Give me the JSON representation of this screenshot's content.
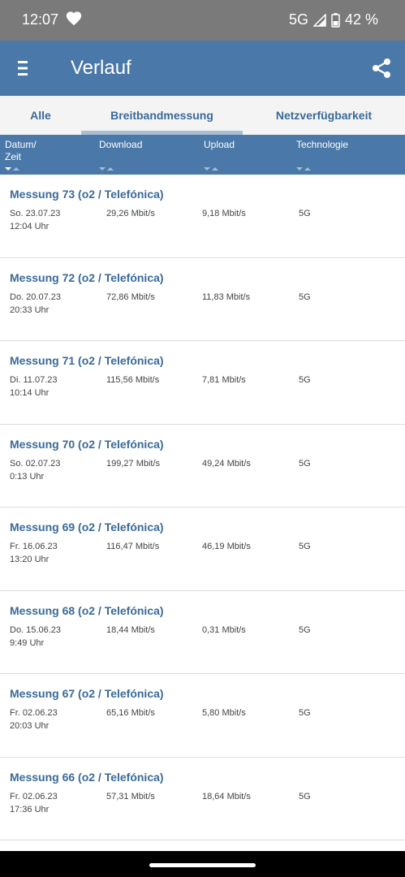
{
  "status_bar": {
    "time": "12:07",
    "network": "5G",
    "battery": "42 %",
    "icons": [
      "heart-icon",
      "signal-icon",
      "battery-icon"
    ]
  },
  "app_bar": {
    "title": "Verlauf",
    "icons": [
      "menu-icon",
      "share-icon"
    ]
  },
  "tabs": [
    {
      "label": "Alle",
      "selected": false
    },
    {
      "label": "Breitbandmessung",
      "selected": true
    },
    {
      "label": "Netzverfügbarkeit",
      "selected": false
    }
  ],
  "columns": {
    "date_line1": "Datum/",
    "date_line2": "Zeit",
    "download": "Download",
    "upload": "Upload",
    "technology": "Technologie"
  },
  "measurements": [
    {
      "title": "Messung 73 (o2 / Telefónica)",
      "date": "So. 23.07.23",
      "time": "12:04 Uhr",
      "download": "29,26 Mbit/s",
      "upload": "9,18 Mbit/s",
      "technology": "5G"
    },
    {
      "title": "Messung 72 (o2 / Telefónica)",
      "date": "Do. 20.07.23",
      "time": "20:33 Uhr",
      "download": "72,86 Mbit/s",
      "upload": "11,83 Mbit/s",
      "technology": "5G"
    },
    {
      "title": "Messung 71 (o2 / Telefónica)",
      "date": "Di. 11.07.23",
      "time": "10:14 Uhr",
      "download": "115,56 Mbit/s",
      "upload": "7,81 Mbit/s",
      "technology": "5G"
    },
    {
      "title": "Messung 70 (o2 / Telefónica)",
      "date": "So. 02.07.23",
      "time": "0:13 Uhr",
      "download": "199,27 Mbit/s",
      "upload": "49,24 Mbit/s",
      "technology": "5G"
    },
    {
      "title": "Messung 69 (o2 / Telefónica)",
      "date": "Fr. 16.06.23",
      "time": "13:20 Uhr",
      "download": "116,47 Mbit/s",
      "upload": "46,19 Mbit/s",
      "technology": "5G"
    },
    {
      "title": "Messung 68 (o2 / Telefónica)",
      "date": "Do. 15.06.23",
      "time": "9:49 Uhr",
      "download": "18,44 Mbit/s",
      "upload": "0,31 Mbit/s",
      "technology": "5G"
    },
    {
      "title": "Messung 67 (o2 / Telefónica)",
      "date": "Fr. 02.06.23",
      "time": "20:03 Uhr",
      "download": "65,16 Mbit/s",
      "upload": "5,80 Mbit/s",
      "technology": "5G"
    },
    {
      "title": "Messung 66 (o2 / Telefónica)",
      "date": "Fr. 02.06.23",
      "time": "17:36 Uhr",
      "download": "57,31 Mbit/s",
      "upload": "18,64 Mbit/s",
      "technology": "5G"
    }
  ],
  "colors": {
    "status_bar": "#7a7a7a",
    "app_bar": "#4a78a8",
    "accent_text": "#3a6a99",
    "tab_indicator": "#a9bdd3",
    "tabs_background": "#f4f4f4"
  }
}
